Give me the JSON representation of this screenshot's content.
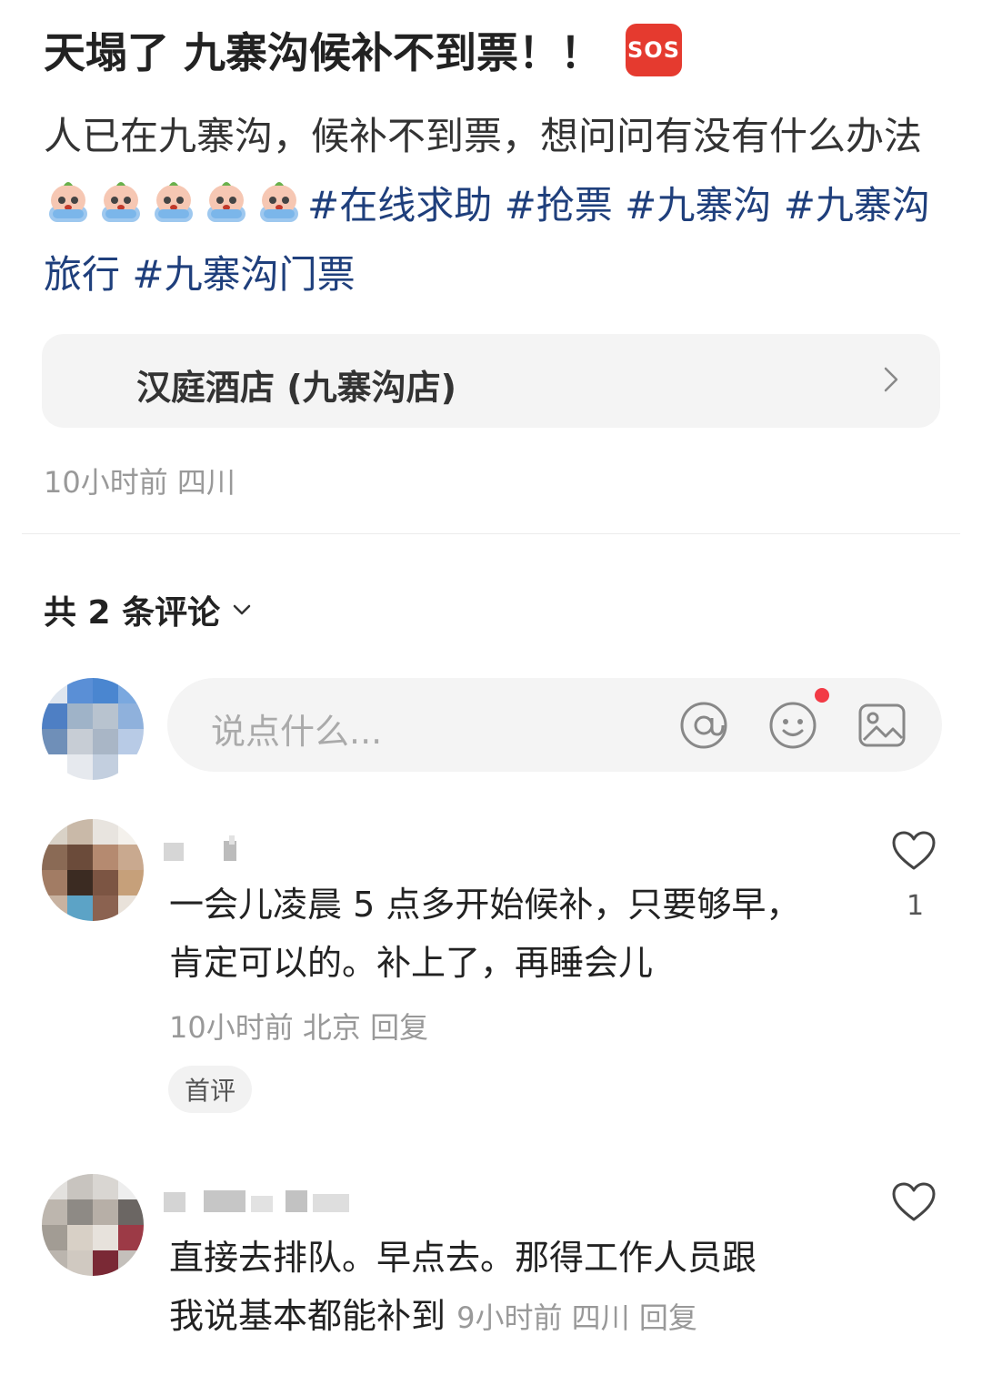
{
  "post": {
    "title": "天塌了 九寨沟候补不到票！！",
    "title_emoji": "SOS",
    "body_text": "人已在九寨沟，候补不到票，想问问有没有什么办法",
    "emoji_name": "crying-peach-emoji",
    "tags": [
      "#在线求助",
      "#抢票",
      "#九寨沟",
      "#九寨沟旅行",
      "#九寨沟门票"
    ],
    "location": "汉庭酒店 (九寨沟店)",
    "time": "10小时前",
    "region": "四川"
  },
  "comments_header": {
    "label": "共 2 条评论"
  },
  "comment_input": {
    "placeholder": "说点什么..."
  },
  "comments": [
    {
      "text_line1": "一会儿凌晨 5 点多开始候补，只要够早，",
      "text_line2": "肯定可以的。补上了，再睡会儿",
      "time": "10小时前",
      "region": "北京",
      "reply": "回复",
      "badge": "首评",
      "likes": "1"
    },
    {
      "text_line1": "直接去排队。早点去。那得工作人员跟",
      "text_line2": "我说基本都能补到",
      "time": "9小时前",
      "region": "四川",
      "reply": "回复"
    }
  ],
  "colors": {
    "tag": "#1f3f7c",
    "sos": "#e53a2f",
    "notify_dot": "#f23a45",
    "muted": "#999999"
  }
}
